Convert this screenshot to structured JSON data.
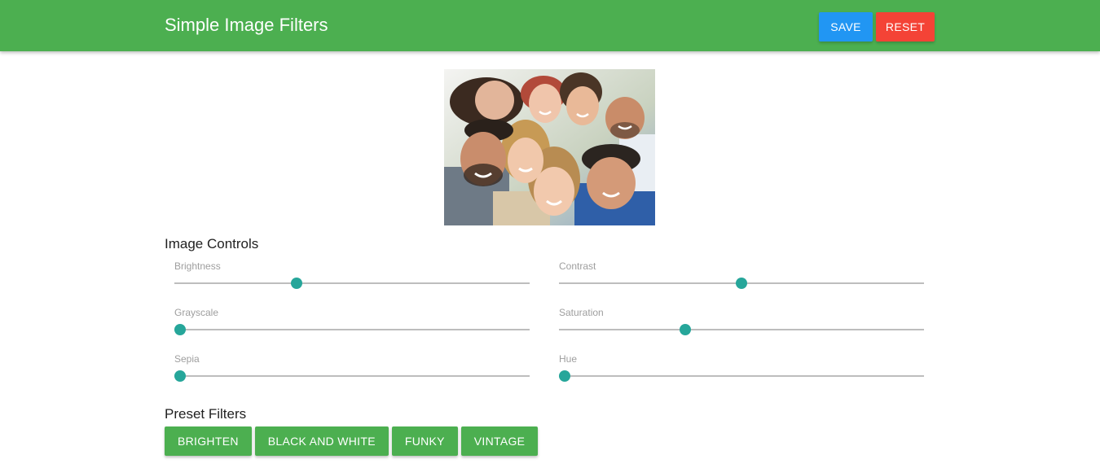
{
  "header": {
    "title": "Simple Image Filters",
    "save_label": "SAVE",
    "reset_label": "RESET",
    "colors": {
      "bar": "#4caf50",
      "save": "#2196f3",
      "reset": "#f44336"
    }
  },
  "image": {
    "description_icon": "group-selfie-photo"
  },
  "controls": {
    "title": "Image Controls",
    "sliders": [
      {
        "label": "Brightness",
        "value_fraction": 0.34
      },
      {
        "label": "Contrast",
        "value_fraction": 0.5
      },
      {
        "label": "Grayscale",
        "value_fraction": 0.0
      },
      {
        "label": "Saturation",
        "value_fraction": 0.34
      },
      {
        "label": "Sepia",
        "value_fraction": 0.0
      },
      {
        "label": "Hue",
        "value_fraction": 0.0
      }
    ],
    "accent": "#26a69a"
  },
  "presets": {
    "title": "Preset Filters",
    "buttons": [
      "BRIGHTEN",
      "BLACK AND WHITE",
      "FUNKY",
      "VINTAGE"
    ]
  }
}
